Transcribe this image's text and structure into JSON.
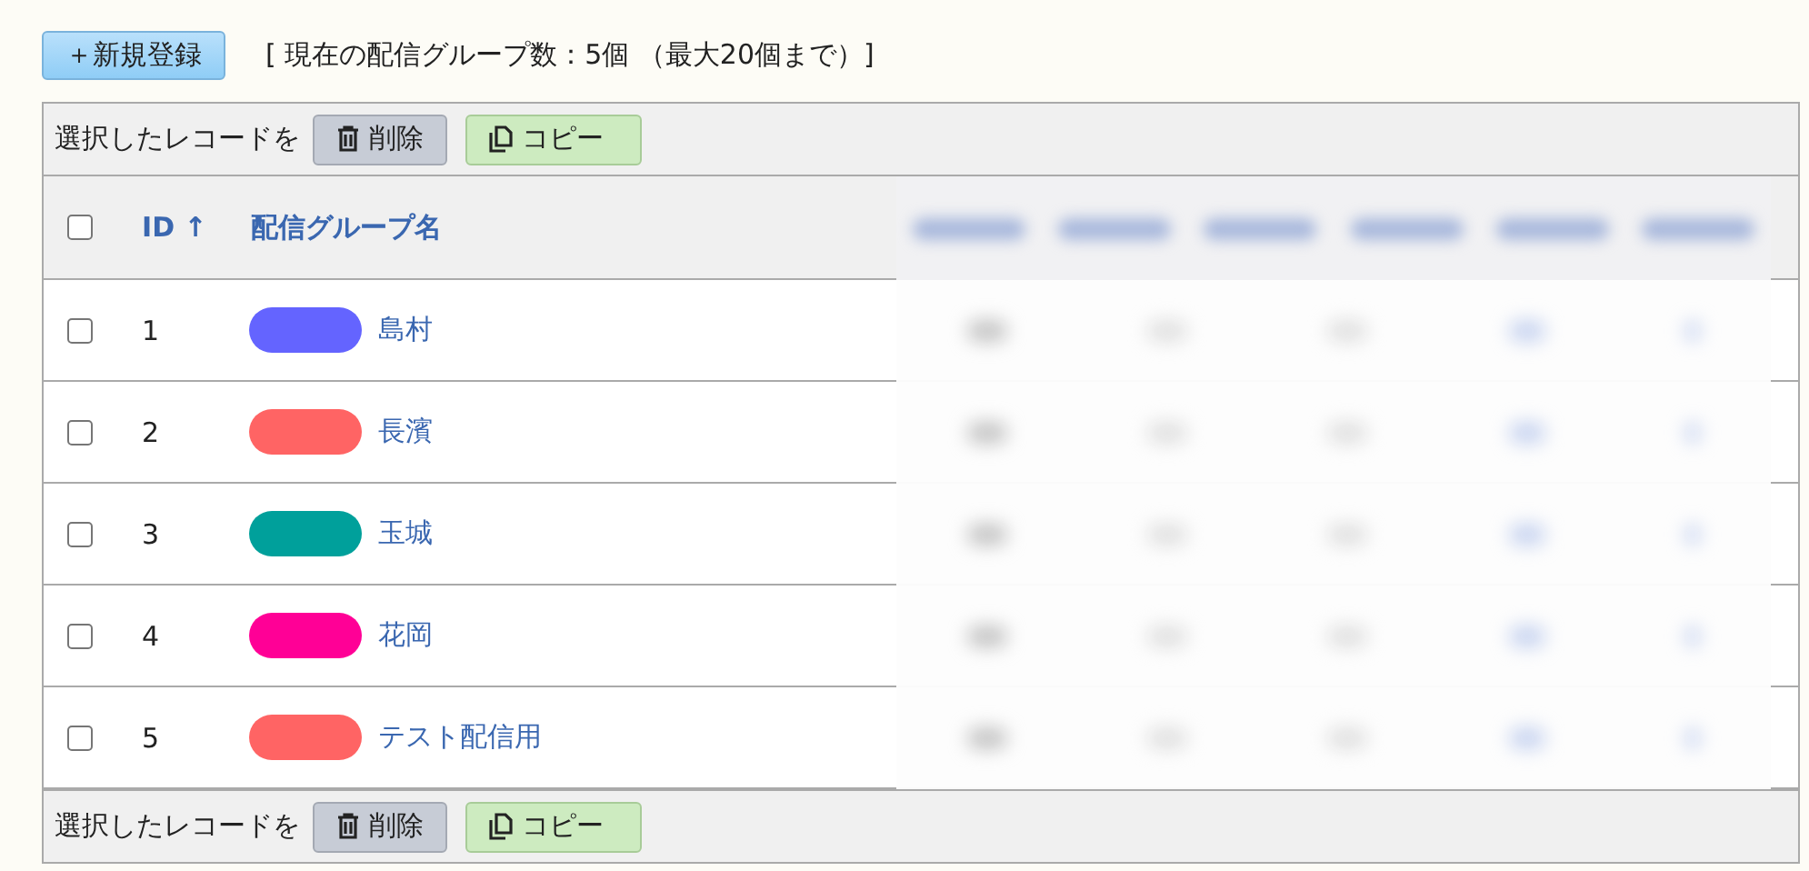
{
  "new_button": {
    "label": "＋新規登録"
  },
  "group_count_text": "[ 現在の配信グループ数：5個 （最大20個まで）]",
  "top_toolbar": {
    "label": "選択したレコードを",
    "delete_label": "削除",
    "copy_label": "コピー"
  },
  "table": {
    "select_all": {
      "checked": false
    },
    "columns": [
      {
        "label": "ID",
        "sort": "↑"
      },
      {
        "label": "配信グループ名"
      }
    ],
    "rows": [
      {
        "checked": false,
        "id": "1",
        "color": "#6464ff",
        "name": "島村"
      },
      {
        "checked": false,
        "id": "2",
        "color": "#ff6464",
        "name": "長濱"
      },
      {
        "checked": false,
        "id": "3",
        "color": "#00a09b",
        "name": "玉城"
      },
      {
        "checked": false,
        "id": "4",
        "color": "#ff0096",
        "name": "花岡"
      },
      {
        "checked": false,
        "id": "5",
        "color": "#ff6464",
        "name": "テスト配信用"
      }
    ]
  },
  "bottom_toolbar": {
    "label": "選択したレコードを",
    "delete_label": "削除",
    "copy_label": "コピー"
  }
}
